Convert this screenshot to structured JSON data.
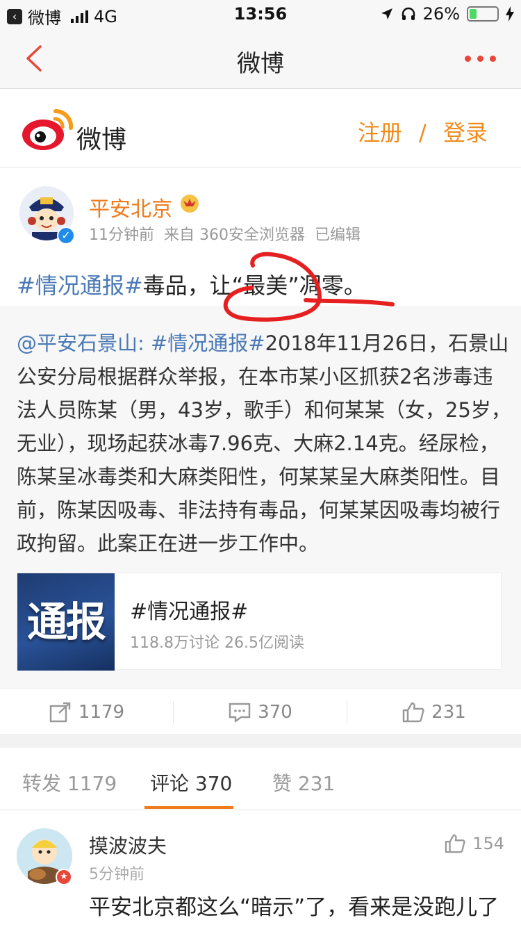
{
  "status_bar": {
    "back_app": "微博",
    "network": "4G",
    "time": "13:56",
    "battery": "26%",
    "battery_level": 0.26
  },
  "nav": {
    "title": "微博",
    "back_icon": "chevron-left-icon",
    "more_icon": "more-dots-icon"
  },
  "brand": {
    "name": "微博",
    "register": "注册",
    "separator": "/",
    "login": "登录"
  },
  "post": {
    "author": "平安北京",
    "meta": "11分钟前  来自 360安全浏览器  已编辑",
    "hashtag": "#情况通报#",
    "text": "毒品，让“最美”凋零。"
  },
  "retweet": {
    "mention": "@平安石景山:",
    "hashtag": "#情况通报#",
    "body": "2018年11月26日，石景山公安分局根据群众举报，在本市某小区抓获2名涉毒违法人员陈某（男，43岁，歌手）和何某某（女，25岁，无业），现场起获冰毒7.96克、大麻2.14克。经尿检，陈某呈冰毒类和大麻类阳性，何某某呈大麻类阳性。目前，陈某因吸毒、非法持有毒品，何某某因吸毒均被行政拘留。此案正在进一步工作中。",
    "topic": {
      "thumb_text": "通报",
      "title": "#情况通报#",
      "stats": "118.8万讨论 26.5亿阅读"
    }
  },
  "actions": {
    "repost_count": "1179",
    "comment_count": "370",
    "like_count": "231"
  },
  "tabs": {
    "repost": "转发 1179",
    "comment": "评论 370",
    "like": "赞 231"
  },
  "comment": {
    "name": "摸波波夫",
    "time": "5分钟前",
    "likes": "154",
    "text": "平安北京都这么“暗示”了，看来是没跑儿了"
  },
  "colors": {
    "accent_orange": "#f07b1d",
    "link_blue": "#4a79b6",
    "nav_red": "#e8473a",
    "annotation_red": "#e62020"
  }
}
